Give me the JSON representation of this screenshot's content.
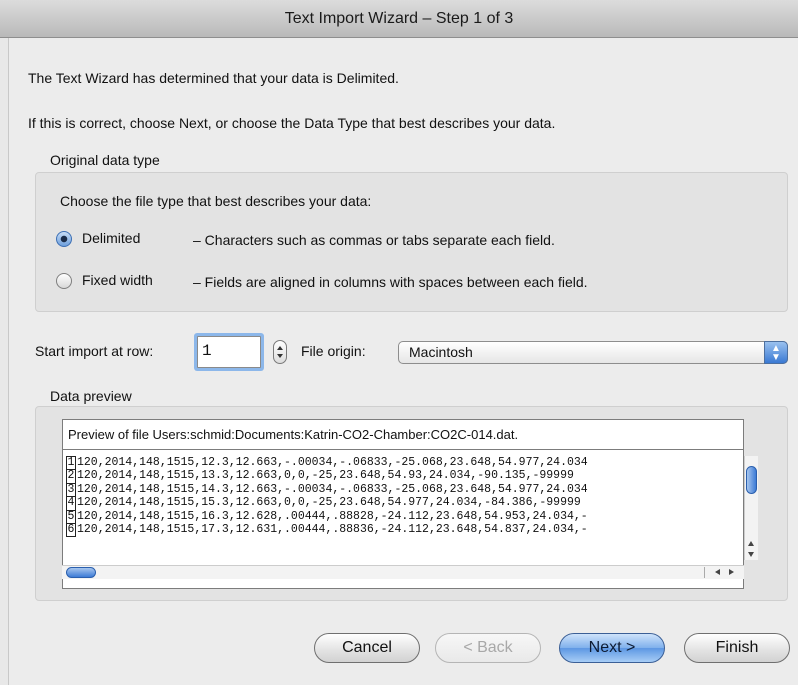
{
  "window": {
    "title": "Text Import Wizard – Step 1 of 3"
  },
  "intro": {
    "line1": "The Text Wizard has determined that your data is Delimited.",
    "line2": "If this is correct, choose Next, or choose the Data Type that best describes your data."
  },
  "original_data_type": {
    "label": "Original data type",
    "prompt": "Choose the file type that best describes your data:",
    "options": [
      {
        "label": "Delimited",
        "description": "– Characters such as commas or tabs separate each field.",
        "selected": true
      },
      {
        "label": "Fixed width",
        "description": "– Fields are aligned in columns with spaces between each field.",
        "selected": false
      }
    ]
  },
  "start_row": {
    "label": "Start import at row:",
    "value": "1"
  },
  "file_origin": {
    "label": "File origin:",
    "value": "Macintosh"
  },
  "preview": {
    "label": "Data preview",
    "header": "Preview of file Users:schmid:Documents:Katrin-CO2-Chamber:CO2C-014.dat.",
    "rows": [
      {
        "num": "1",
        "text": "120,2014,148,1515,12.3,12.663,-.00034,-.06833,-25.068,23.648,54.977,24.034"
      },
      {
        "num": "2",
        "text": "120,2014,148,1515,13.3,12.663,0,0,-25,23.648,54.93,24.034,-90.135,-99999"
      },
      {
        "num": "3",
        "text": "120,2014,148,1515,14.3,12.663,-.00034,-.06833,-25.068,23.648,54.977,24.034"
      },
      {
        "num": "4",
        "text": "120,2014,148,1515,15.3,12.663,0,0,-25,23.648,54.977,24.034,-84.386,-99999"
      },
      {
        "num": "5",
        "text": "120,2014,148,1515,16.3,12.628,.00444,.88828,-24.112,23.648,54.953,24.034,-"
      },
      {
        "num": "6",
        "text": "120,2014,148,1515,17.3,12.631,.00444,.88836,-24.112,23.648,54.837,24.034,-"
      }
    ]
  },
  "buttons": {
    "cancel": "Cancel",
    "back": "< Back",
    "next": "Next >",
    "finish": "Finish"
  }
}
